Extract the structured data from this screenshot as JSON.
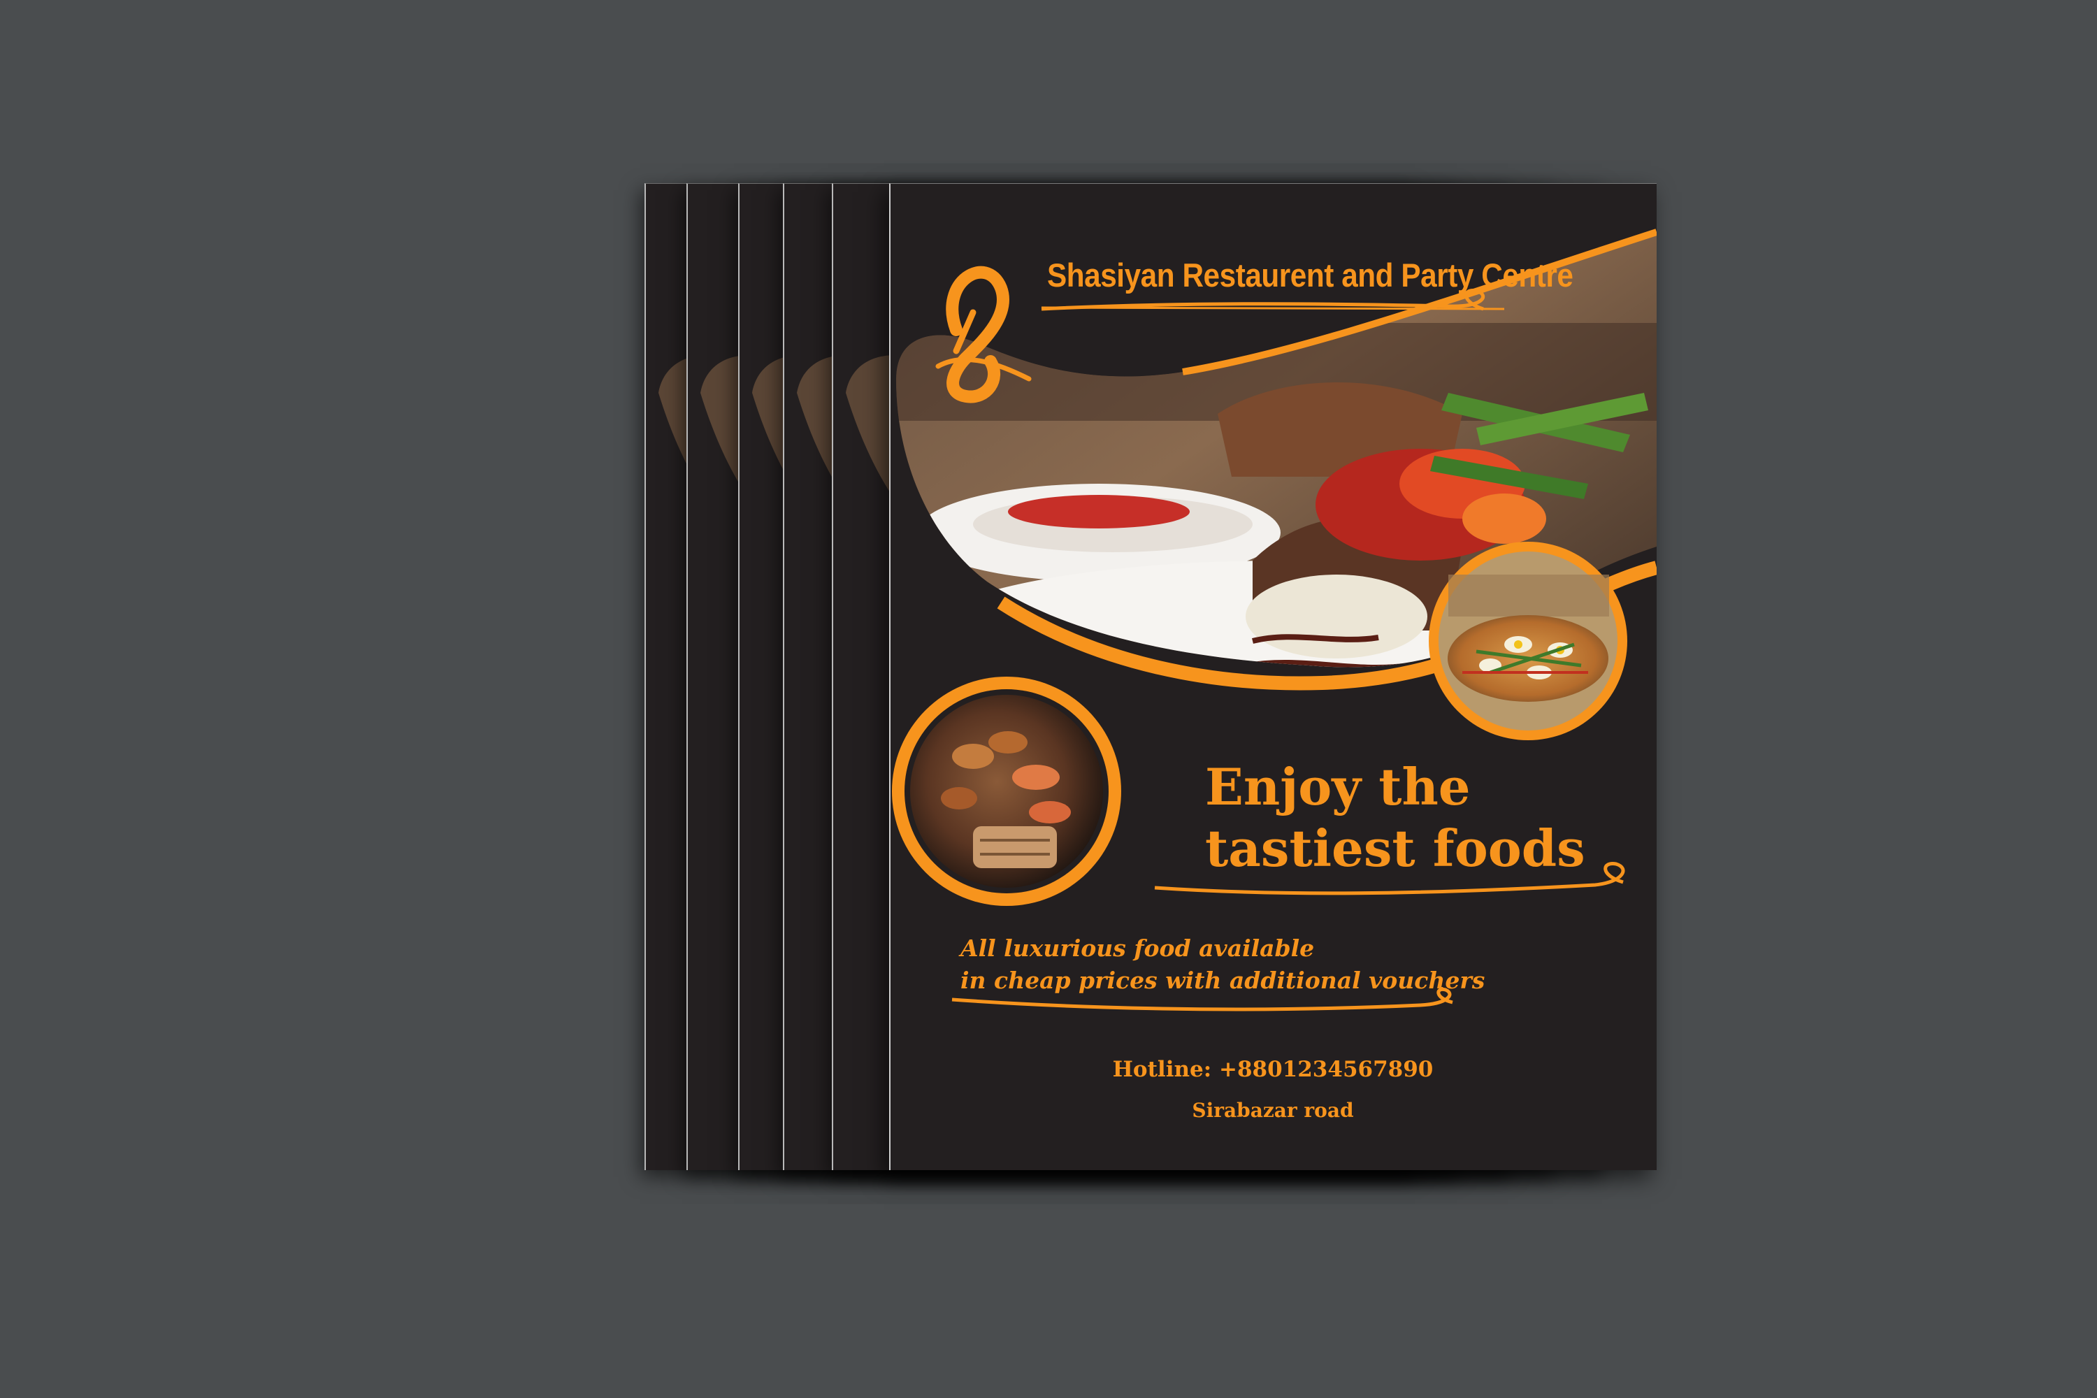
{
  "flyer": {
    "brand_name": "Shasiyan Restaurent and Party Centre",
    "logo_icon": "s-monogram-logo-icon",
    "headline": "Enjoy the\ntastiest foods",
    "tagline": "All luxurious food available\nin cheap prices with additional vouchers",
    "hotline": "Hotline: +8801234567890",
    "address": "Sirabazar road"
  },
  "colors": {
    "background": "#4a4d4f",
    "flyer": "#231f20",
    "accent": "#f7941d"
  },
  "stack_copies": 5
}
